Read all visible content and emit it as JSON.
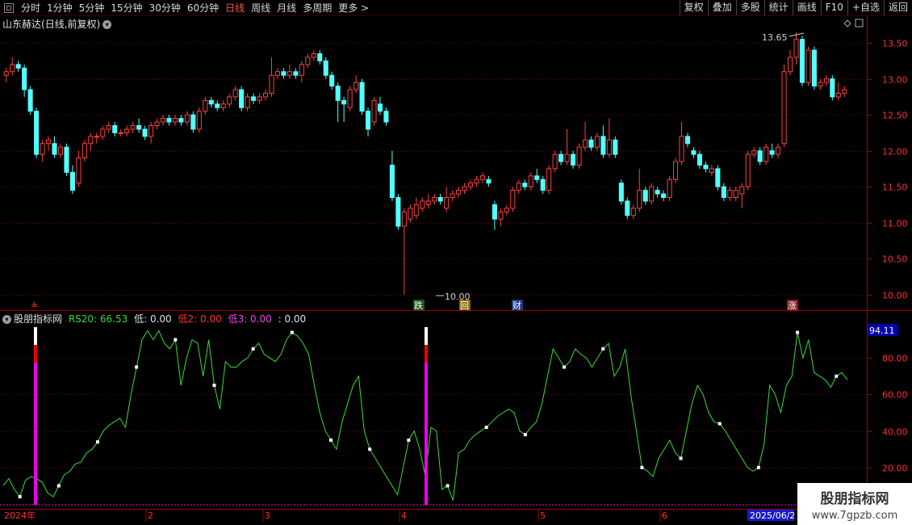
{
  "toolbar": {
    "items": [
      "分时",
      "1分钟",
      "5分钟",
      "15分钟",
      "30分钟",
      "60分钟",
      "日线",
      "周线",
      "月线",
      "多周期",
      "更多 >"
    ],
    "active_index": 6,
    "right_buttons": [
      "复权",
      "叠加",
      "多股",
      "统计",
      "画线",
      "F10",
      "+自选",
      "返回"
    ]
  },
  "title": {
    "stock": "山东赫达",
    "mode": "(日线,前复权)"
  },
  "indicator": {
    "name": "股朋指标网",
    "rs_label": "RS20: 66.53",
    "low_label": "低: 0.00",
    "low2_label": "低2: 0.00",
    "low3_label": "低3: 0.00",
    "extra_label": ": 0.00",
    "value_box": "94.11"
  },
  "markers": {
    "high": "13.65",
    "low": "10.00",
    "event1": "跌",
    "event2": "回",
    "event3": "财",
    "event4": "涨",
    "left_mark": "≗"
  },
  "date_axis": {
    "start": "2024年",
    "m2": "2",
    "m3": "3",
    "m4": "4",
    "m5": "5",
    "m6": "6",
    "end": "2025/06/2"
  },
  "watermark": {
    "title": "股朋指标网",
    "url": "www.7gpzb.com"
  },
  "colors": {
    "up": "#ff4040",
    "down": "#52ffff",
    "line": "#33dd33",
    "bar_white": "#ffffff",
    "bar_red": "#ee0000",
    "bar_magenta": "#ee00ee"
  },
  "chart_data": [
    {
      "type": "candlestick",
      "y_ticks": [
        10.0,
        10.5,
        11.0,
        11.5,
        12.0,
        12.5,
        13.0,
        13.5
      ],
      "ylim": [
        9.85,
        13.85
      ],
      "candles": [
        [
          13.05,
          13.1,
          12.95,
          13.15
        ],
        [
          13.1,
          13.2,
          13.05,
          13.3
        ],
        [
          13.2,
          13.15,
          13.1,
          13.25
        ],
        [
          13.15,
          12.85,
          12.75,
          13.2
        ],
        [
          12.85,
          12.55,
          12.5,
          12.9
        ],
        [
          12.55,
          11.95,
          11.9,
          12.6
        ],
        [
          11.95,
          12.1,
          11.85,
          12.15
        ],
        [
          12.1,
          12.15,
          12.0,
          12.2
        ],
        [
          12.1,
          11.95,
          11.9,
          12.2
        ],
        [
          11.95,
          12.05,
          11.9,
          12.1
        ],
        [
          12.05,
          11.7,
          11.65,
          12.1
        ],
        [
          11.7,
          11.45,
          11.4,
          11.8
        ],
        [
          11.55,
          11.9,
          11.5,
          12.0
        ],
        [
          11.9,
          12.1,
          11.85,
          12.15
        ],
        [
          12.1,
          12.2,
          12.0,
          12.25
        ],
        [
          12.2,
          12.2,
          12.1,
          12.25
        ],
        [
          12.2,
          12.3,
          12.15,
          12.35
        ],
        [
          12.3,
          12.35,
          12.25,
          12.4
        ],
        [
          12.35,
          12.25,
          12.2,
          12.4
        ],
        [
          12.25,
          12.25,
          12.2,
          12.3
        ],
        [
          12.25,
          12.3,
          12.2,
          12.35
        ],
        [
          12.3,
          12.35,
          12.25,
          12.4
        ],
        [
          12.35,
          12.3,
          12.25,
          12.45
        ],
        [
          12.3,
          12.2,
          12.15,
          12.35
        ],
        [
          12.2,
          12.35,
          12.1,
          12.4
        ],
        [
          12.35,
          12.4,
          12.3,
          12.45
        ],
        [
          12.4,
          12.45,
          12.35,
          12.5
        ],
        [
          12.45,
          12.4,
          12.35,
          12.5
        ],
        [
          12.4,
          12.45,
          12.35,
          12.5
        ],
        [
          12.45,
          12.4,
          12.35,
          12.5
        ],
        [
          12.4,
          12.5,
          12.35,
          12.55
        ],
        [
          12.5,
          12.3,
          12.25,
          12.55
        ],
        [
          12.3,
          12.55,
          12.25,
          12.6
        ],
        [
          12.55,
          12.7,
          12.5,
          12.75
        ],
        [
          12.7,
          12.65,
          12.6,
          12.75
        ],
        [
          12.65,
          12.6,
          12.55,
          12.7
        ],
        [
          12.6,
          12.65,
          12.55,
          12.7
        ],
        [
          12.65,
          12.75,
          12.6,
          12.8
        ],
        [
          12.75,
          12.85,
          12.7,
          12.9
        ],
        [
          12.85,
          12.6,
          12.55,
          12.9
        ],
        [
          12.6,
          12.75,
          12.55,
          12.8
        ],
        [
          12.75,
          12.7,
          12.65,
          12.8
        ],
        [
          12.7,
          12.75,
          12.65,
          12.8
        ],
        [
          12.75,
          12.8,
          12.7,
          12.85
        ],
        [
          12.8,
          13.05,
          12.75,
          13.3
        ],
        [
          13.05,
          13.1,
          13.0,
          13.15
        ],
        [
          13.1,
          13.05,
          13.0,
          13.15
        ],
        [
          13.05,
          13.1,
          13.0,
          13.2
        ],
        [
          13.1,
          13.05,
          13.0,
          13.15
        ],
        [
          13.05,
          13.2,
          12.95,
          13.25
        ],
        [
          13.2,
          13.3,
          13.15,
          13.35
        ],
        [
          13.3,
          13.35,
          13.25,
          13.4
        ],
        [
          13.35,
          13.25,
          13.2,
          13.4
        ],
        [
          13.25,
          13.05,
          13.0,
          13.3
        ],
        [
          13.05,
          12.9,
          12.85,
          13.1
        ],
        [
          12.9,
          12.7,
          12.4,
          12.95
        ],
        [
          12.7,
          12.65,
          12.4,
          12.75
        ],
        [
          12.6,
          12.85,
          12.55,
          12.9
        ],
        [
          12.85,
          12.95,
          12.8,
          13.05
        ],
        [
          12.95,
          12.55,
          12.5,
          13.0
        ],
        [
          12.55,
          12.3,
          12.2,
          12.6
        ],
        [
          12.4,
          12.7,
          12.35,
          12.75
        ],
        [
          12.65,
          12.55,
          12.5,
          12.75
        ],
        [
          12.55,
          12.4,
          12.35,
          12.6
        ],
        [
          11.8,
          11.35,
          11.3,
          12.0
        ],
        [
          11.35,
          10.95,
          10.9,
          11.4
        ],
        [
          10.95,
          11.15,
          10.0,
          11.2
        ],
        [
          11.05,
          11.2,
          11.0,
          11.25
        ],
        [
          11.1,
          11.25,
          11.05,
          11.35
        ],
        [
          11.2,
          11.3,
          11.15,
          11.35
        ],
        [
          11.25,
          11.3,
          11.2,
          11.4
        ],
        [
          11.3,
          11.35,
          11.25,
          11.4
        ],
        [
          11.35,
          11.3,
          11.25,
          11.4
        ],
        [
          11.2,
          11.35,
          11.15,
          11.5
        ],
        [
          11.35,
          11.4,
          11.3,
          11.45
        ],
        [
          11.4,
          11.45,
          11.35,
          11.5
        ],
        [
          11.45,
          11.5,
          11.4,
          11.55
        ],
        [
          11.5,
          11.55,
          11.45,
          11.6
        ],
        [
          11.55,
          11.6,
          11.5,
          11.65
        ],
        [
          11.6,
          11.65,
          11.55,
          11.7
        ],
        [
          11.6,
          11.55,
          11.5,
          11.65
        ],
        [
          11.25,
          11.05,
          10.9,
          11.3
        ],
        [
          11.05,
          11.15,
          10.95,
          11.2
        ],
        [
          11.15,
          11.2,
          11.1,
          11.25
        ],
        [
          11.2,
          11.45,
          11.15,
          11.5
        ],
        [
          11.45,
          11.55,
          11.4,
          11.6
        ],
        [
          11.55,
          11.5,
          11.45,
          11.6
        ],
        [
          11.5,
          11.65,
          11.45,
          11.7
        ],
        [
          11.65,
          11.6,
          11.55,
          11.75
        ],
        [
          11.6,
          11.45,
          11.4,
          11.65
        ],
        [
          11.45,
          11.75,
          11.4,
          11.8
        ],
        [
          11.75,
          11.95,
          11.7,
          12.0
        ],
        [
          11.95,
          11.85,
          11.8,
          12.0
        ],
        [
          11.85,
          11.95,
          11.8,
          12.3
        ],
        [
          11.95,
          11.8,
          11.75,
          12.0
        ],
        [
          11.8,
          12.05,
          11.75,
          12.1
        ],
        [
          12.05,
          12.15,
          12.0,
          12.4
        ],
        [
          12.15,
          12.05,
          12.0,
          12.2
        ],
        [
          12.05,
          12.2,
          12.0,
          12.25
        ],
        [
          12.2,
          11.95,
          11.9,
          12.35
        ],
        [
          11.95,
          12.15,
          11.9,
          12.45
        ],
        [
          12.15,
          11.95,
          11.9,
          12.2
        ],
        [
          11.55,
          11.3,
          11.25,
          11.6
        ],
        [
          11.3,
          11.1,
          11.05,
          11.35
        ],
        [
          11.1,
          11.2,
          11.05,
          11.25
        ],
        [
          11.2,
          11.45,
          11.15,
          11.75
        ],
        [
          11.45,
          11.3,
          11.25,
          11.5
        ],
        [
          11.3,
          11.5,
          11.25,
          11.55
        ],
        [
          11.45,
          11.4,
          11.35,
          11.5
        ],
        [
          11.4,
          11.35,
          11.3,
          11.45
        ],
        [
          11.35,
          11.6,
          11.3,
          11.65
        ],
        [
          11.6,
          11.85,
          11.55,
          11.9
        ],
        [
          11.85,
          12.2,
          11.8,
          12.4
        ],
        [
          12.2,
          12.1,
          12.05,
          12.25
        ],
        [
          12.0,
          11.95,
          11.9,
          12.05
        ],
        [
          11.95,
          11.8,
          11.75,
          12.0
        ],
        [
          11.8,
          11.75,
          11.7,
          11.85
        ],
        [
          11.7,
          11.75,
          11.65,
          11.8
        ],
        [
          11.75,
          11.5,
          11.45,
          11.8
        ],
        [
          11.5,
          11.35,
          11.3,
          11.55
        ],
        [
          11.35,
          11.45,
          11.3,
          11.5
        ],
        [
          11.35,
          11.45,
          11.3,
          11.5
        ],
        [
          11.4,
          11.5,
          11.2,
          11.55
        ],
        [
          11.5,
          11.95,
          11.45,
          12.0
        ],
        [
          11.95,
          12.0,
          11.9,
          12.05
        ],
        [
          12.0,
          11.85,
          11.8,
          12.05
        ],
        [
          11.85,
          12.05,
          11.8,
          12.1
        ],
        [
          12.0,
          11.95,
          11.9,
          12.1
        ],
        [
          11.95,
          12.05,
          11.9,
          12.1
        ],
        [
          12.1,
          13.1,
          12.05,
          13.2
        ],
        [
          13.1,
          13.3,
          13.05,
          13.4
        ],
        [
          13.3,
          13.55,
          13.2,
          13.65
        ],
        [
          13.55,
          12.95,
          12.9,
          13.6
        ],
        [
          12.95,
          13.4,
          12.9,
          13.45
        ],
        [
          13.4,
          12.9,
          12.85,
          13.45
        ],
        [
          12.9,
          12.95,
          12.85,
          13.0
        ],
        [
          12.95,
          13.0,
          12.9,
          13.05
        ],
        [
          13.0,
          12.75,
          12.7,
          13.05
        ],
        [
          12.75,
          12.8,
          12.7,
          12.95
        ],
        [
          12.8,
          12.85,
          12.75,
          12.9
        ]
      ]
    },
    {
      "type": "line",
      "series": [
        {
          "name": "RS20",
          "values": [
            10,
            14,
            8,
            4,
            13,
            15,
            14,
            12,
            6,
            4,
            10,
            16,
            18,
            22,
            23,
            28,
            30,
            34,
            40,
            43,
            45,
            47,
            42,
            60,
            75,
            90,
            95,
            90,
            95,
            88,
            85,
            90,
            65,
            80,
            90,
            88,
            70,
            90,
            65,
            52,
            78,
            75,
            75,
            78,
            80,
            85,
            88,
            82,
            80,
            78,
            82,
            90,
            94,
            92,
            88,
            82,
            65,
            50,
            40,
            35,
            30,
            45,
            55,
            65,
            70,
            40,
            30,
            25,
            20,
            15,
            10,
            5,
            20,
            35,
            40,
            30,
            15,
            42,
            40,
            8,
            10,
            2,
            28,
            30,
            35,
            38,
            40,
            42,
            45,
            48,
            50,
            52,
            50,
            40,
            38,
            42,
            45,
            55,
            70,
            85,
            80,
            75,
            78,
            85,
            82,
            80,
            75,
            80,
            85,
            88,
            70,
            75,
            85,
            60,
            40,
            20,
            18,
            15,
            25,
            30,
            35,
            28,
            25,
            40,
            55,
            65,
            60,
            50,
            45,
            44,
            40,
            35,
            30,
            25,
            20,
            18,
            20,
            33,
            65,
            60,
            50,
            65,
            70,
            94,
            80,
            90,
            72,
            70,
            68,
            64,
            70,
            72,
            68
          ]
        }
      ],
      "y_ticks": [
        20.0,
        40.0,
        60.0,
        80.0
      ],
      "ylim": [
        0,
        100
      ]
    }
  ]
}
